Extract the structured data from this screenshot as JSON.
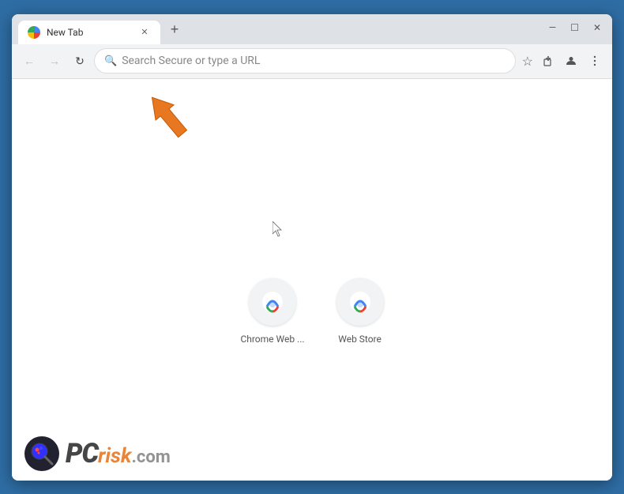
{
  "window": {
    "title": "New Tab",
    "controls": {
      "minimize": "—",
      "maximize": "☐",
      "close": "✕"
    }
  },
  "toolbar": {
    "back_label": "←",
    "forward_label": "→",
    "reload_label": "↻",
    "address_placeholder": "Search Secure or type a URL",
    "bookmark_icon": "☆",
    "extensions_icon": "⚙",
    "profile_icon": "👤",
    "menu_icon": "⋮"
  },
  "shortcuts": [
    {
      "label": "Chrome Web ...",
      "id": "chrome-web"
    },
    {
      "label": "Web Store",
      "id": "web-store"
    }
  ],
  "watermark": {
    "pc_text": "PC",
    "risk_text": "risk",
    "domain_text": ".com"
  },
  "new_tab_btn": "+",
  "colors": {
    "accent_orange": "#e87722",
    "chrome_blue": "#4285f4",
    "chrome_red": "#ea4335",
    "chrome_yellow": "#fbbc05",
    "chrome_green": "#34a853",
    "border_blue": "#2e6da4"
  }
}
